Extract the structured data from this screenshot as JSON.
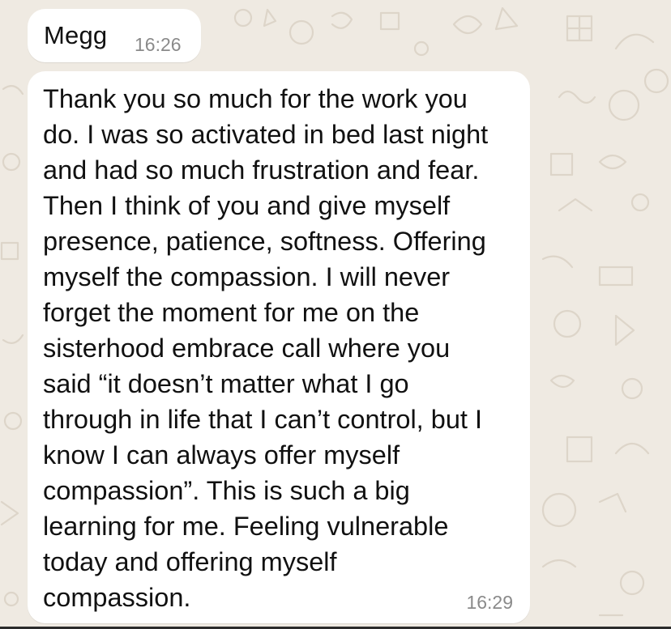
{
  "chat": {
    "sender": "Megg",
    "messages": [
      {
        "time": "16:26"
      },
      {
        "text": "Thank you so much for the work you\ndo. I was so activated in bed last night\nand had so much frustration and fear.\nThen I think of you and give myself\npresence, patience, softness. Offering\nmyself the compassion. I will never\nforget the moment for me on the\nsisterhood embrace call where you\nsaid “it doesn’t matter what I go\nthrough in life that I can’t control, but I\nknow I can always offer myself\ncompassion”. This is such a big\nlearning for me. Feeling vulnerable\ntoday and offering myself\ncompassion.",
        "time": "16:29"
      }
    ]
  },
  "colors": {
    "chat_background": "#efeae2",
    "bubble": "#ffffff",
    "doodle": "#ddd5c9",
    "timestamp": "#8a8a8a"
  }
}
